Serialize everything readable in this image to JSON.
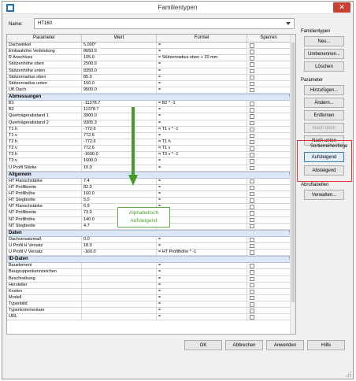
{
  "window": {
    "title": "Familientypen"
  },
  "name": {
    "label": "Name:",
    "value": "HT160"
  },
  "columns": [
    "Parameter",
    "Wert",
    "Formel",
    "Sperren"
  ],
  "rows_top": [
    [
      "Dachwinkel",
      "5.000°",
      "="
    ],
    [
      "Einbauhöhe Verbindung",
      "8650.0",
      "="
    ],
    [
      "R Anschluss",
      "105.0",
      "= Stützenradius oben + 20 mm"
    ],
    [
      "Stützenhöhe oben",
      "2500.0",
      "="
    ],
    [
      "Stützenhöhe unten",
      "8350.0",
      "="
    ],
    [
      "Stützenradius oben",
      "85.0",
      "="
    ],
    [
      "Stützenradius unten",
      "150.0",
      "="
    ],
    [
      "UK Dach",
      "9500.0",
      "="
    ]
  ],
  "groups": [
    {
      "name": "Abmessungen",
      "rows": [
        [
          "B1",
          "-11378.7",
          "= B2 * -1"
        ],
        [
          "B2",
          "11378.7",
          "="
        ],
        [
          "Querträgerabstand 1",
          "3900.0",
          "="
        ],
        [
          "Querträgerabstand 2",
          "9305.3",
          "="
        ],
        [
          "T1 h",
          "-772.6",
          "= T1 v * -1"
        ],
        [
          "T1 v",
          "772.6",
          "="
        ],
        [
          "T2 h",
          "-772.6",
          "= T1 h"
        ],
        [
          "T2 v",
          "772.6",
          "= T1 v"
        ],
        [
          "T3 h",
          "-1600.0",
          "= T3 v * -1"
        ],
        [
          "T3 v",
          "1600.0",
          "="
        ],
        [
          "U Profil Stärke",
          "10.0",
          "="
        ]
      ]
    },
    {
      "name": "Allgemein",
      "rows": [
        [
          "HT Flanschstärke",
          "7.4",
          "="
        ],
        [
          "HT Profilbreite",
          "82.0",
          "="
        ],
        [
          "HT Profilhöhe",
          "160.0",
          "="
        ],
        [
          "HT Stegbreite",
          "5.0",
          "="
        ],
        [
          "NT Flanschstärke",
          "6.9",
          "="
        ],
        [
          "NT Profilbreite",
          "73.0",
          "="
        ],
        [
          "NT Profilhöhe",
          "140.0",
          "="
        ],
        [
          "NT Stegbreite",
          "4.7",
          "="
        ]
      ]
    },
    {
      "name": "Daten",
      "rows": [
        [
          "Dachversatzmaß",
          "0.0",
          "="
        ],
        [
          "U Profil H Versatz",
          "18.0",
          "="
        ],
        [
          "U Profil V Versatz",
          "-160.0",
          "= HT Profilhöhe * -1"
        ]
      ]
    },
    {
      "name": "ID-Daten",
      "rows": [
        [
          "Bauelement",
          "",
          "="
        ],
        [
          "Baugruppenkennzeichen",
          "",
          "="
        ],
        [
          "Beschreibung",
          "",
          "="
        ],
        [
          "Hersteller",
          "",
          "="
        ],
        [
          "Kosten",
          "",
          "="
        ],
        [
          "Modell",
          "",
          "="
        ],
        [
          "Typenbild",
          "",
          "="
        ],
        [
          "Typenkommentare",
          "",
          "="
        ],
        [
          "URL",
          "",
          "="
        ]
      ]
    }
  ],
  "side": {
    "familientypen": {
      "label": "Familientypen",
      "neu": "Neu...",
      "umbenennen": "Umbenennen...",
      "loeschen": "Löschen"
    },
    "parameter": {
      "label": "Parameter",
      "hinzufuegen": "Hinzufügen...",
      "aendern": "Ändern...",
      "entfernen": "Entfernen",
      "nach_oben": "Nach oben",
      "nach_unten": "Nach unten"
    },
    "sort": {
      "label": "Sortierreihenfolge",
      "auf": "Aufsteigend",
      "ab": "Absteigend"
    },
    "abruf": {
      "label": "Abruftabellen",
      "verwalten": "Verwalten..."
    }
  },
  "callout": {
    "line1": "Alphabetisch",
    "line2": "Aufsteigend"
  },
  "footer": {
    "ok": "OK",
    "abbrechen": "Abbrechen",
    "anwenden": "Anwenden",
    "hilfe": "Hilfe"
  },
  "colors": {
    "red": "#e33333",
    "green": "#4a9a2a",
    "group_bg": "#dce6f4"
  }
}
